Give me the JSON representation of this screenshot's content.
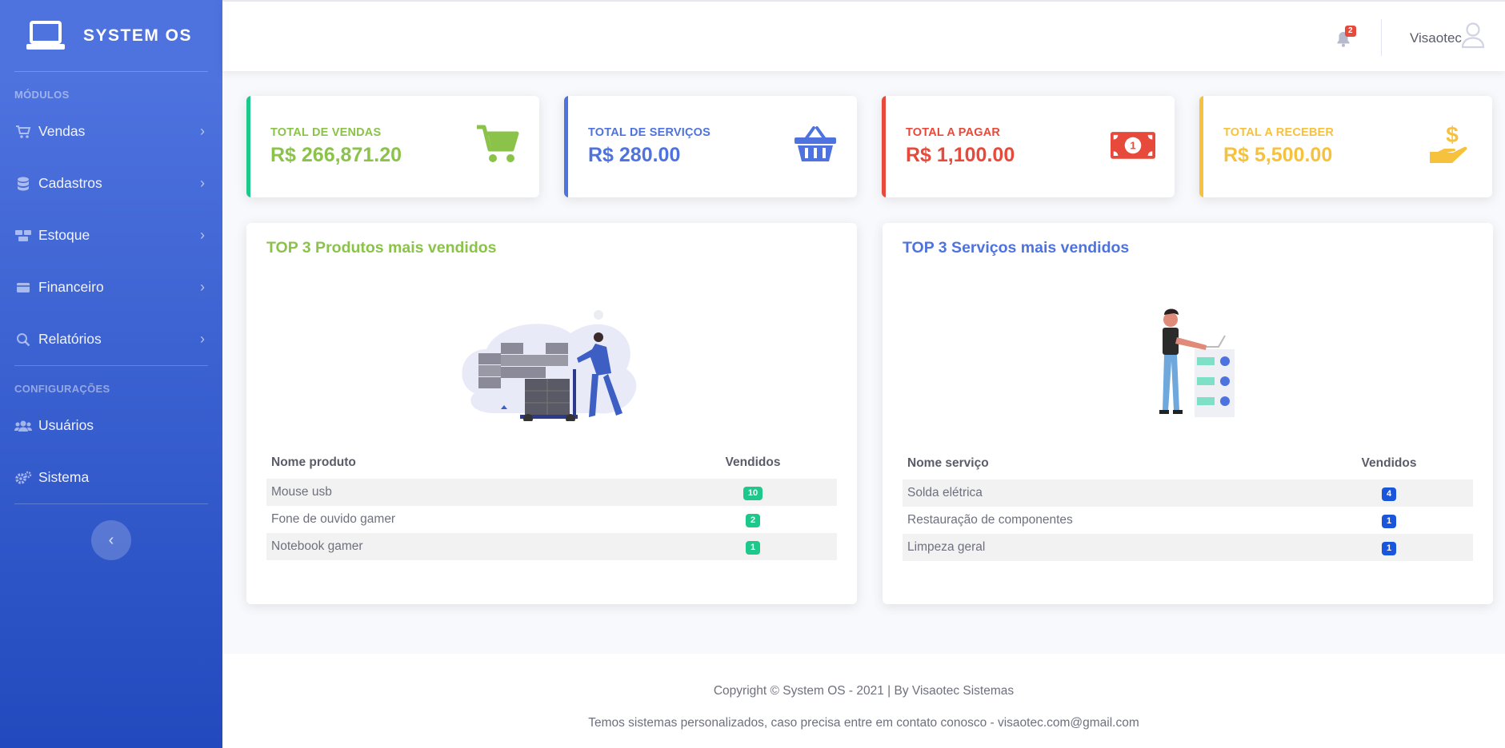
{
  "brand": {
    "name": "SYSTEM OS",
    "icon": "laptop-icon"
  },
  "sidebar": {
    "modules_heading": "MÓDULOS",
    "modules": [
      {
        "label": "Vendas",
        "icon": "cart-icon"
      },
      {
        "label": "Cadastros",
        "icon": "database-icon"
      },
      {
        "label": "Estoque",
        "icon": "boxes-icon"
      },
      {
        "label": "Financeiro",
        "icon": "wallet-icon"
      },
      {
        "label": "Relatórios",
        "icon": "search-report-icon"
      }
    ],
    "config_heading": "CONFIGURAÇÕES",
    "config": [
      {
        "label": "Usuários",
        "icon": "users-icon"
      },
      {
        "label": "Sistema",
        "icon": "cogs-icon"
      }
    ],
    "toggle_glyph": "‹"
  },
  "topbar": {
    "notification_count": "2",
    "user_name": "Visaotec"
  },
  "stats": [
    {
      "title": "TOTAL DE VENDAS",
      "value": "R$ 266,871.20",
      "color": "#8bc34a",
      "bar": "#1cc88a",
      "icon": "shopping-cart-icon"
    },
    {
      "title": "TOTAL DE SERVIÇOS",
      "value": "R$ 280.00",
      "color": "#4e73df",
      "bar": "#4e73df",
      "icon": "basket-icon"
    },
    {
      "title": "TOTAL A PAGAR",
      "value": "R$ 1,100.00",
      "color": "#e74a3b",
      "bar": "#e74a3b",
      "icon": "money-bill-icon"
    },
    {
      "title": "TOTAL A RECEBER",
      "value": "R$ 5,500.00",
      "color": "#f6c23e",
      "bar": "#f6c23e",
      "icon": "hand-dollar-icon"
    }
  ],
  "products": {
    "title": "TOP 3 Produtos mais vendidos",
    "col_name": "Nome produto",
    "col_sold": "Vendidos",
    "rows": [
      {
        "name": "Mouse usb",
        "sold": "10"
      },
      {
        "name": "Fone de ouvido gamer",
        "sold": "2"
      },
      {
        "name": "Notebook gamer",
        "sold": "1"
      }
    ],
    "badge_color": "#1cc88a"
  },
  "services": {
    "title": "TOP 3 Serviços mais vendidos",
    "col_name": "Nome serviço",
    "col_sold": "Vendidos",
    "rows": [
      {
        "name": "Solda elétrica",
        "sold": "4"
      },
      {
        "name": "Restauração de componentes",
        "sold": "1"
      },
      {
        "name": "Limpeza geral",
        "sold": "1"
      }
    ],
    "badge_color": "#1a56db"
  },
  "footer": {
    "line1": "Copyright © System OS - 2021  | By Visaotec Sistemas",
    "line2": "Temos sistemas personalizados, caso precisa entre em contato conosco - visaotec.com@gmail.com"
  }
}
